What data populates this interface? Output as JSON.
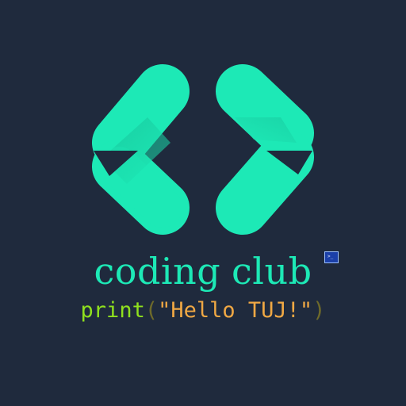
{
  "club": {
    "word1": "coding",
    "word2": "club"
  },
  "code": {
    "keyword": "print",
    "open_paren": "(",
    "string": "\"Hello TUJ!\"",
    "close_paren": ")"
  },
  "badge": {
    "prompt": ">_",
    "icon": "terminal-icon"
  },
  "colors": {
    "background": "#1f2a3d",
    "accent": "#1de9b6",
    "keyword": "#8fe01e",
    "paren": "#6e6a2a",
    "string": "#f0a844",
    "badge": "#1b3fa8"
  }
}
